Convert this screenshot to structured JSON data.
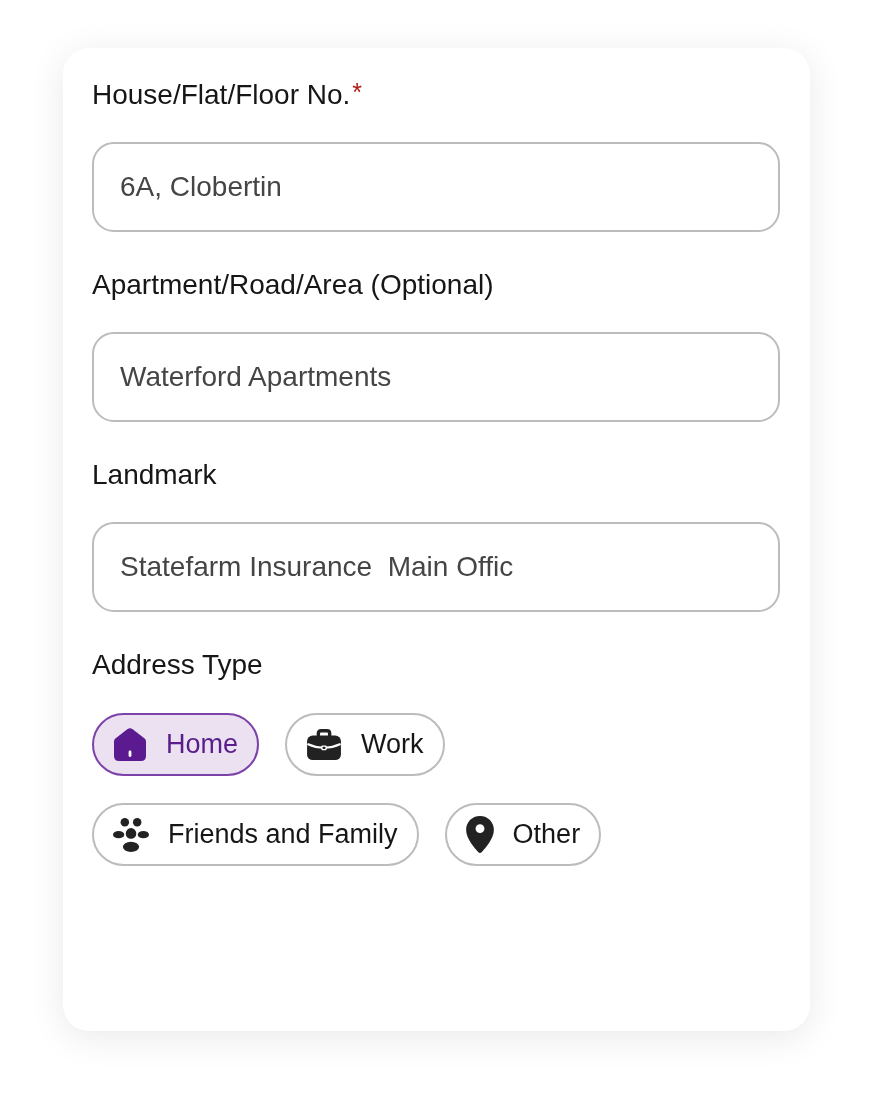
{
  "fields": [
    {
      "label": "House/Flat/Floor No.",
      "required_mark": "*",
      "value": "6A, Clobertin"
    },
    {
      "label": "Apartment/Road/Area (Optional)",
      "value": "Waterford Apartments"
    },
    {
      "label": "Landmark",
      "value": "Statefarm Insurance  Main Offic"
    }
  ],
  "address_type": {
    "label": "Address Type",
    "options": [
      {
        "kind": "home",
        "label": "Home",
        "selected": true
      },
      {
        "kind": "work",
        "label": "Work",
        "selected": false
      },
      {
        "kind": "friends",
        "label": "Friends and Family",
        "selected": false
      },
      {
        "kind": "other",
        "label": "Other",
        "selected": false
      }
    ]
  }
}
